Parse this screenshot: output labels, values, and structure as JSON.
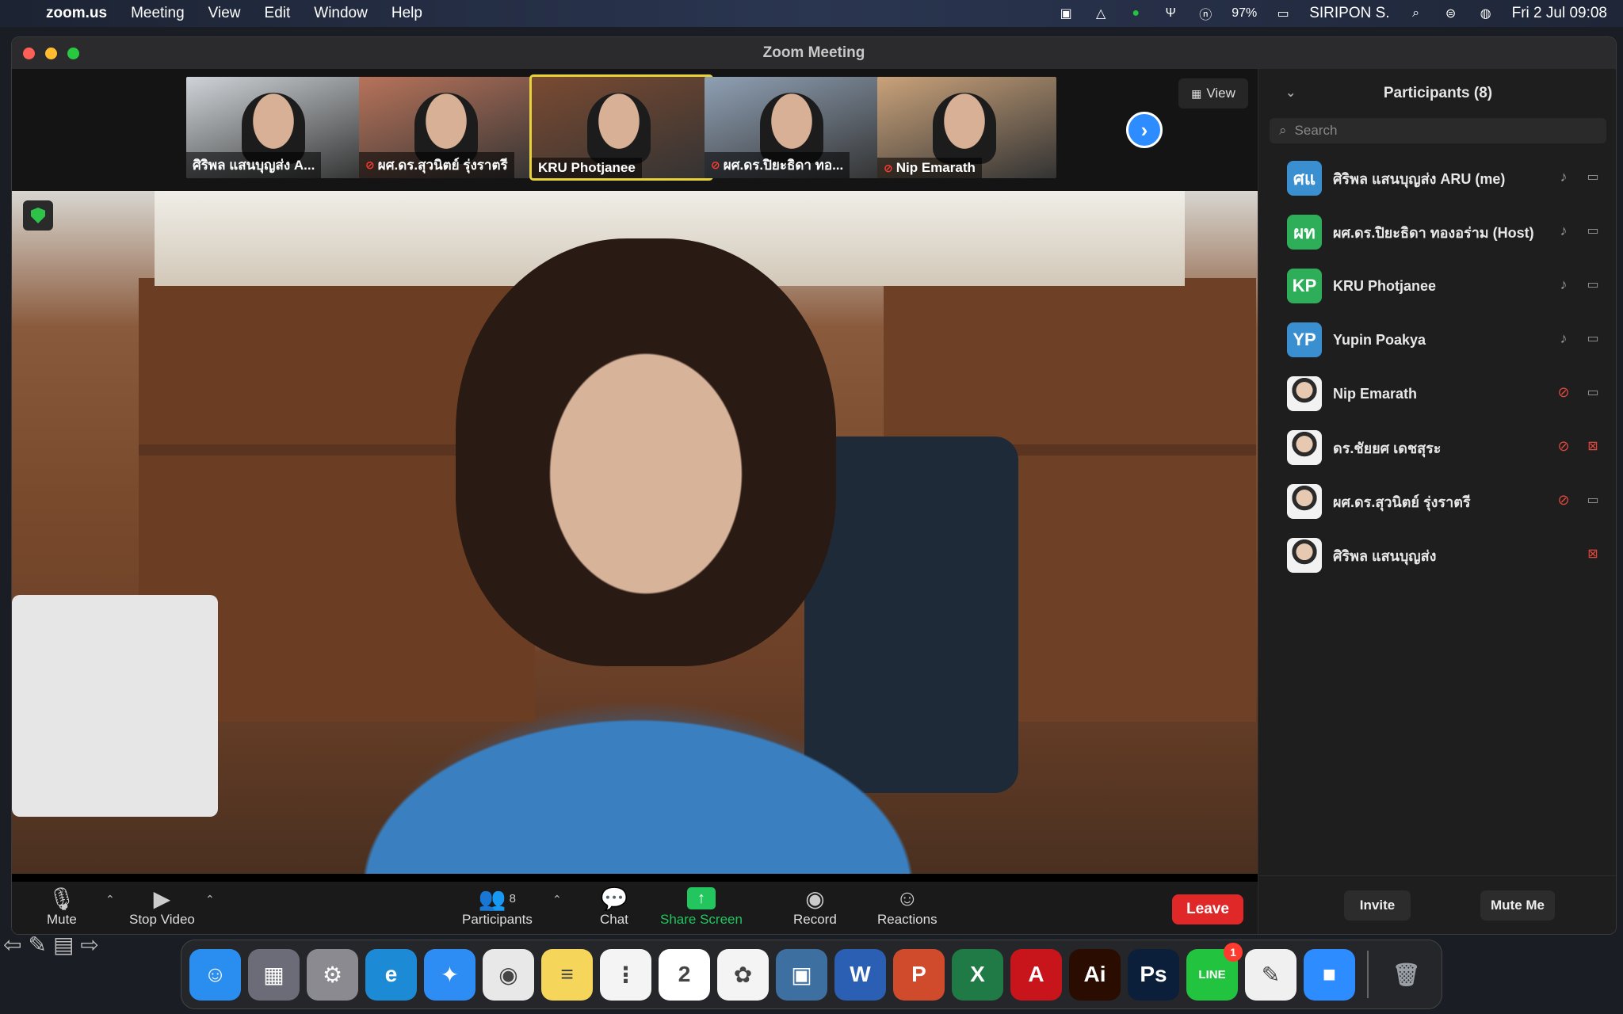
{
  "menubar": {
    "apple": "",
    "items": [
      "zoom.us",
      "Meeting",
      "View",
      "Edit",
      "Window",
      "Help"
    ],
    "battery": "97%",
    "user": "SIRIPON S.",
    "datetime": "Fri 2 Jul  09:08"
  },
  "window": {
    "title": "Zoom Meeting"
  },
  "thumbnails": [
    {
      "name": "ศิริพล แสนบุญส่ง A...",
      "muted": false,
      "active": false,
      "bg": "#cfd4d8"
    },
    {
      "name": "ผศ.ดร.สุวนิตย์ รุ่งราตรี",
      "muted": true,
      "active": false,
      "bg": "#b7735a"
    },
    {
      "name": "KRU Photjanee",
      "muted": false,
      "active": true,
      "bg": "#7a4a32"
    },
    {
      "name": "ผศ.ดร.ปิยะธิดา ทอ...",
      "muted": true,
      "active": false,
      "bg": "#8fa0b4"
    },
    {
      "name": "Nip Emarath",
      "muted": true,
      "active": false,
      "bg": "#c9a27a"
    }
  ],
  "view_button": "View",
  "toolbar": {
    "mute": "Mute",
    "stop_video": "Stop Video",
    "participants": "Participants",
    "participants_count": "8",
    "chat": "Chat",
    "share_screen": "Share Screen",
    "record": "Record",
    "reactions": "Reactions",
    "leave": "Leave"
  },
  "panel": {
    "title": "Participants (8)",
    "search_placeholder": "Search",
    "participants": [
      {
        "initials": "ศแ",
        "name": "ศิริพล แสนบุญส่ง ARU (me)",
        "color": "#3a8fd0",
        "mic": "on",
        "cam": "on"
      },
      {
        "initials": "ผท",
        "name": "ผศ.ดร.ปิยะธิดา ทองอร่าม (Host)",
        "color": "#2fae5a",
        "mic": "on",
        "cam": "on"
      },
      {
        "initials": "KP",
        "name": "KRU Photjanee",
        "color": "#2fae5a",
        "mic": "on",
        "cam": "on"
      },
      {
        "initials": "YP",
        "name": "Yupin Poakya",
        "color": "#3a8fd0",
        "mic": "on",
        "cam": "on"
      },
      {
        "initials": "",
        "name": "Nip Emarath",
        "color": "photo",
        "mic": "off",
        "cam": "on"
      },
      {
        "initials": "",
        "name": "ดร.ชัยยศ เดชสุระ",
        "color": "photo",
        "mic": "off",
        "cam": "off"
      },
      {
        "initials": "",
        "name": "ผศ.ดร.สุวนิตย์ รุ่งราตรี",
        "color": "photo",
        "mic": "off",
        "cam": "on"
      },
      {
        "initials": "",
        "name": "ศิริพล แสนบุญส่ง",
        "color": "photo",
        "mic": "none",
        "cam": "off"
      }
    ],
    "invite": "Invite",
    "mute_me": "Mute Me"
  },
  "dock": {
    "apps": [
      {
        "icon": "finder-icon",
        "color": "#2a8df0",
        "glyph": "☺"
      },
      {
        "icon": "launchpad-icon",
        "color": "#6c6c78",
        "glyph": "▦"
      },
      {
        "icon": "system-preferences-icon",
        "color": "#8a8a90",
        "glyph": "⚙"
      },
      {
        "icon": "edge-icon",
        "color": "#1d8ad6",
        "glyph": "e"
      },
      {
        "icon": "safari-icon",
        "color": "#2e8df5",
        "glyph": "✦"
      },
      {
        "icon": "chrome-icon",
        "color": "#e8e8e8",
        "glyph": "◉"
      },
      {
        "icon": "notes-icon",
        "color": "#f5d65a",
        "glyph": "≡"
      },
      {
        "icon": "reminders-icon",
        "color": "#f4f4f4",
        "glyph": "⋮"
      },
      {
        "icon": "calendar-icon",
        "color": "#ffffff",
        "glyph": "2"
      },
      {
        "icon": "photos-icon",
        "color": "#f4f4f4",
        "glyph": "✿"
      },
      {
        "icon": "remote-desktop-icon",
        "color": "#3d6fa0",
        "glyph": "▣"
      },
      {
        "icon": "word-icon",
        "color": "#2b5fb3",
        "glyph": "W"
      },
      {
        "icon": "powerpoint-icon",
        "color": "#d04a2c",
        "glyph": "P"
      },
      {
        "icon": "excel-icon",
        "color": "#1f7a45",
        "glyph": "X"
      },
      {
        "icon": "acrobat-icon",
        "color": "#c8141b",
        "glyph": "A"
      },
      {
        "icon": "illustrator-icon",
        "color": "#2a0d00",
        "glyph": "Ai"
      },
      {
        "icon": "photoshop-icon",
        "color": "#0b1f3a",
        "glyph": "Ps"
      },
      {
        "icon": "line-icon",
        "color": "#22c33f",
        "glyph": "LINE",
        "badge": "1"
      },
      {
        "icon": "textedit-icon",
        "color": "#f0f0f0",
        "glyph": "✎"
      },
      {
        "icon": "zoom-icon",
        "color": "#2d8cff",
        "glyph": "■"
      }
    ],
    "trash": {
      "icon": "trash-icon",
      "color": "#9aa0a6",
      "glyph": "🗑"
    }
  }
}
